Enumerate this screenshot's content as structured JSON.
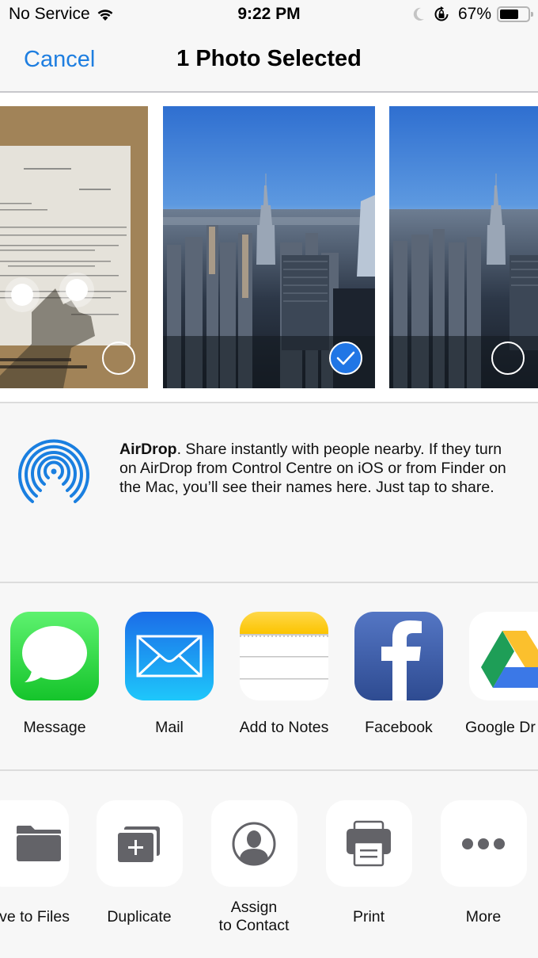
{
  "status_bar": {
    "carrier": "No Service",
    "time": "9:22 PM",
    "battery_percent_text": "67%",
    "battery_level": 0.67,
    "icons": [
      "wifi-icon",
      "moon-icon",
      "orientation-lock-icon",
      "battery-icon"
    ]
  },
  "nav": {
    "cancel_label": "Cancel",
    "title": "1 Photo Selected"
  },
  "photos": [
    {
      "description": "Photo of a typed document under plastic",
      "selected": false
    },
    {
      "description": "New York City skyline with Empire State Building",
      "selected": true
    },
    {
      "description": "New York City skyline with Empire State Building",
      "selected": false
    }
  ],
  "airdrop": {
    "title": "AirDrop",
    "description": ". Share instantly with people nearby. If they turn on AirDrop from Control Centre on iOS or from Finder on the Mac, you’ll see their names here. Just tap to share."
  },
  "apps": [
    {
      "label": "Message",
      "icon": "messages-icon",
      "color": "#34c759"
    },
    {
      "label": "Mail",
      "icon": "mail-icon",
      "color": "#1b8ef0"
    },
    {
      "label": "Add to Notes",
      "icon": "notes-icon",
      "color": "#ffcc00"
    },
    {
      "label": "Facebook",
      "icon": "facebook-icon",
      "color": "#3b5998"
    },
    {
      "label": "Google Dr",
      "icon": "google-drive-icon",
      "color": "#ffffff"
    }
  ],
  "actions": [
    {
      "label": "ve to Files",
      "icon": "folder-icon"
    },
    {
      "label": "Duplicate",
      "icon": "duplicate-icon"
    },
    {
      "label_line1": "Assign",
      "label_line2": "to Contact",
      "icon": "contact-icon"
    },
    {
      "label": "Print",
      "icon": "printer-icon"
    },
    {
      "label": "More",
      "icon": "more-icon"
    }
  ],
  "colors": {
    "accent": "#1e7ee0",
    "selected_check": "#2176e5",
    "airdrop_blue": "#1a7fe0",
    "action_icon_gray": "#636368",
    "background": "#f7f7f7"
  }
}
